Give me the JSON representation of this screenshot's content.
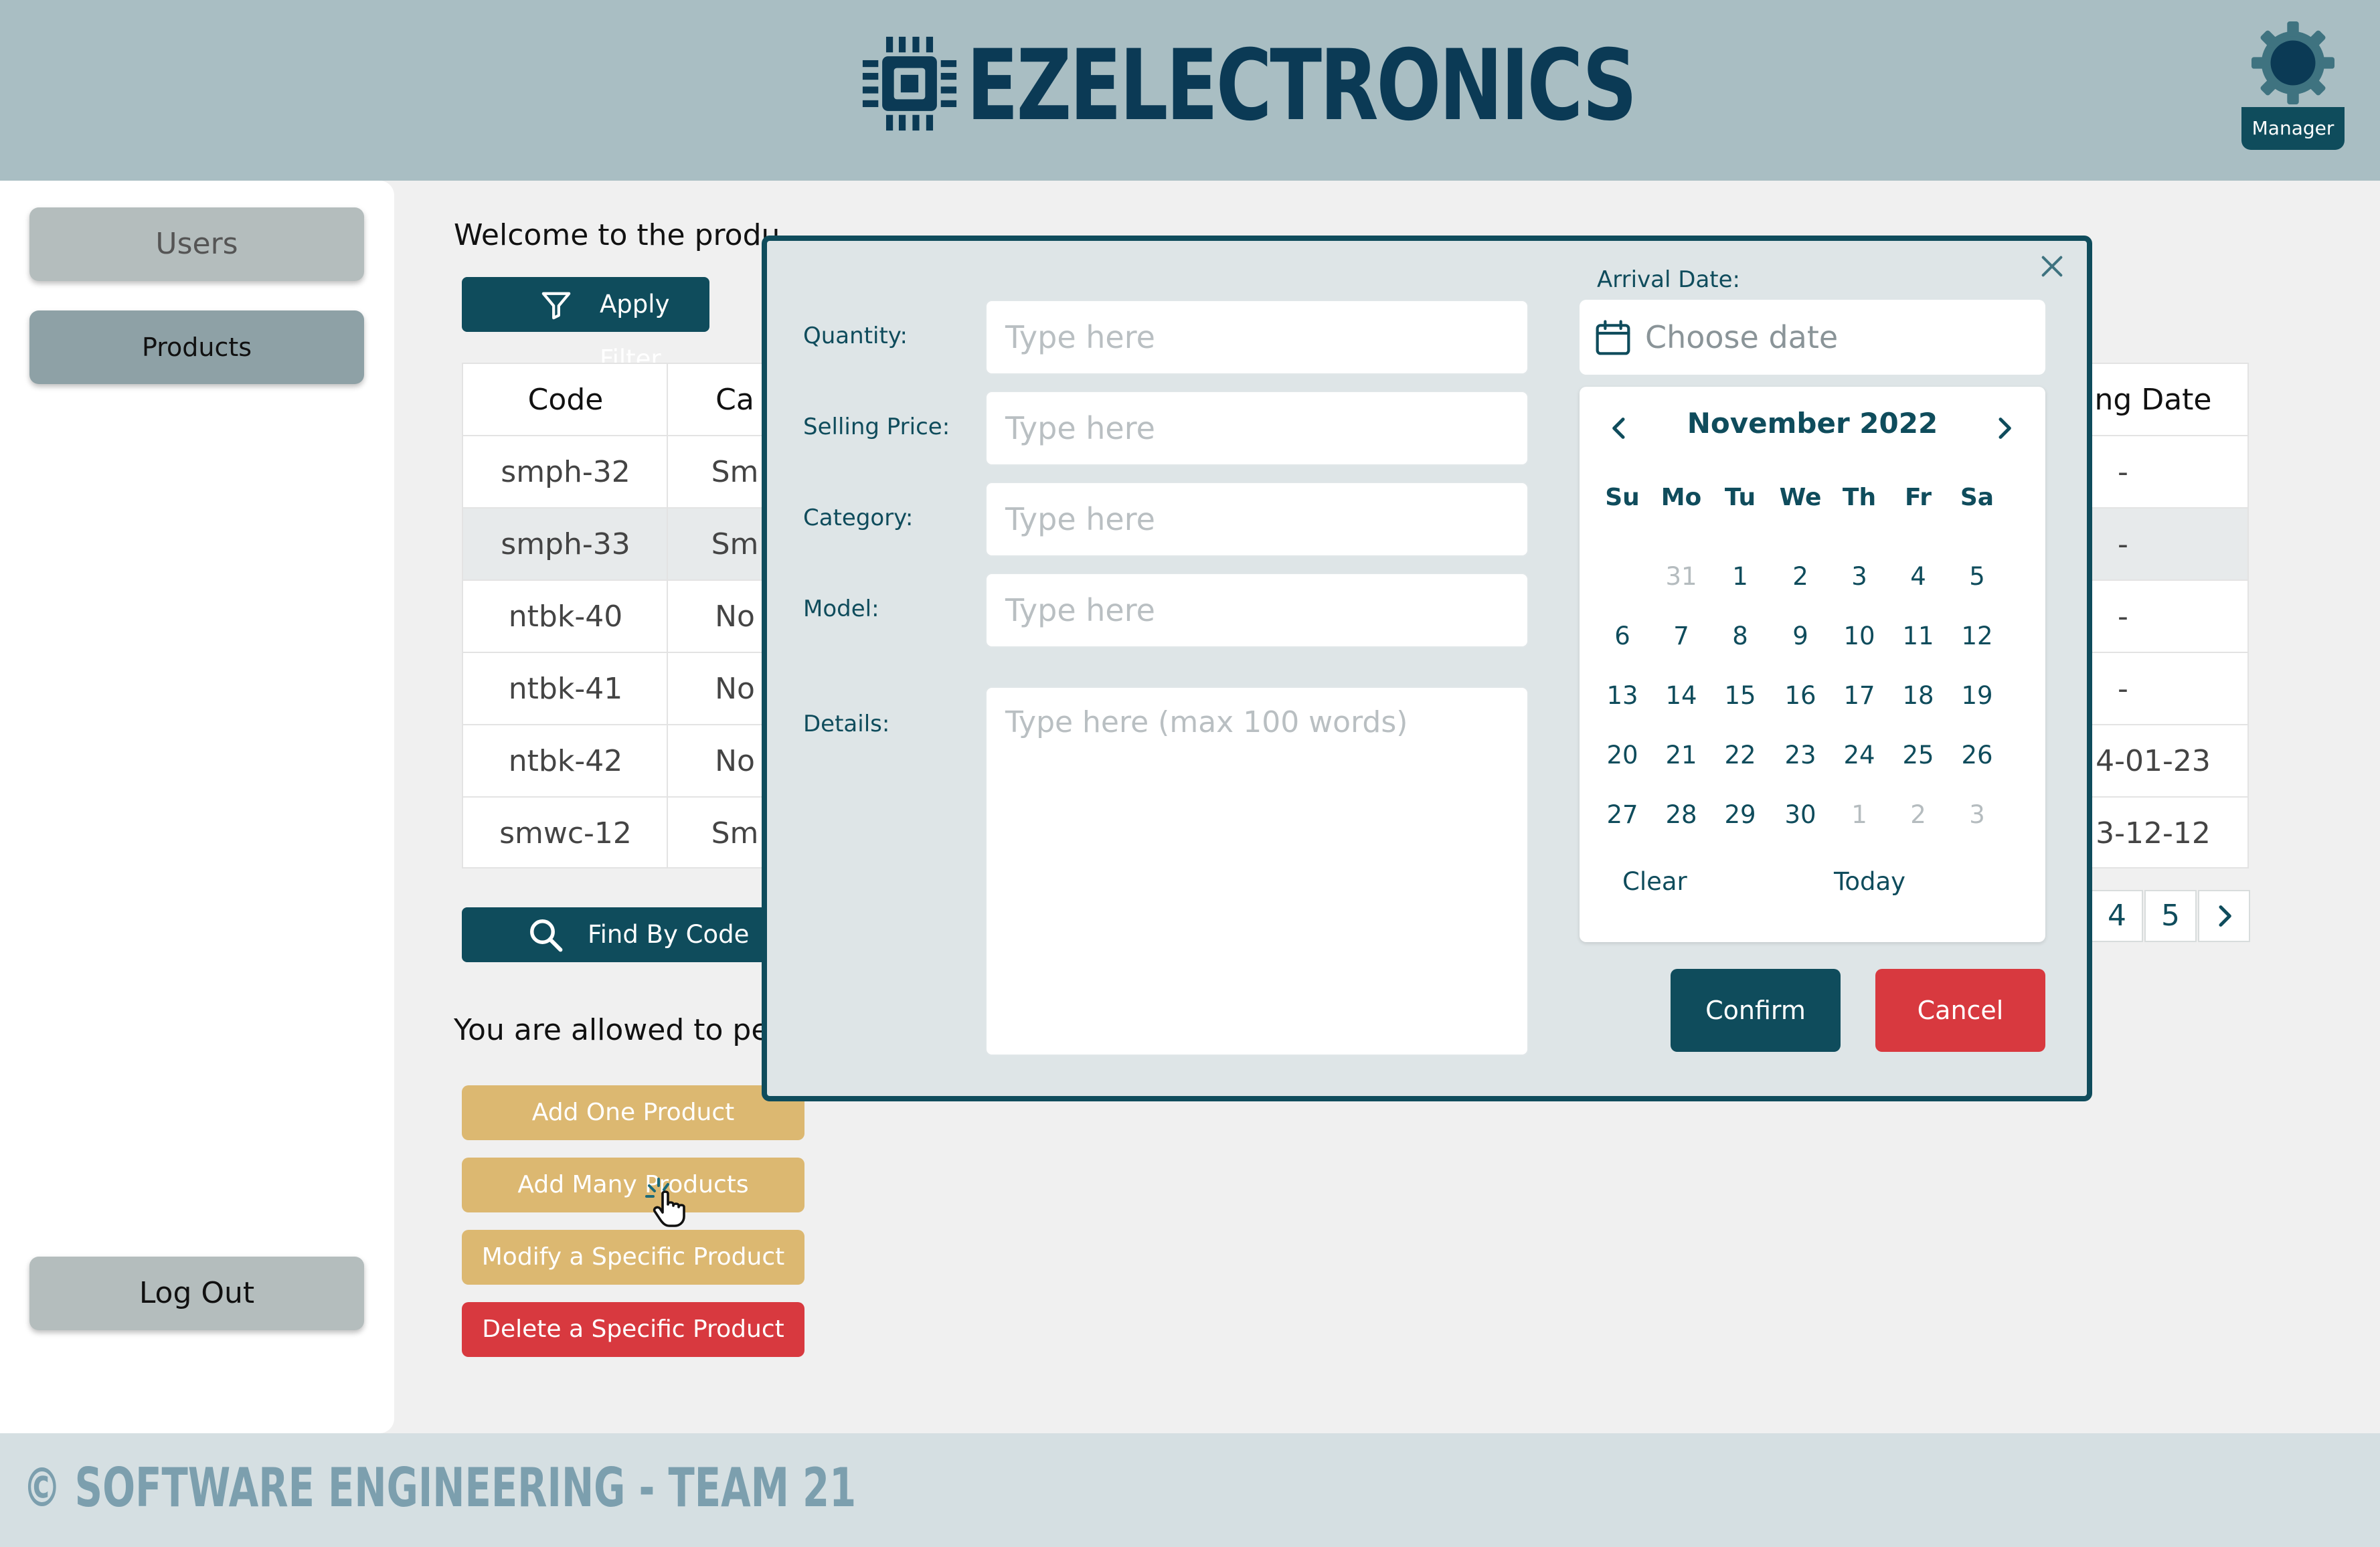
{
  "header": {
    "brand": "EZELECTRONICS",
    "role": "Manager"
  },
  "sidebar": {
    "items": [
      {
        "label": "Users"
      },
      {
        "label": "Products"
      }
    ],
    "logout": "Log Out"
  },
  "main": {
    "welcome": "Welcome to the produ",
    "apply_filter": "Apply Filter",
    "find_by_code": "Find By Code",
    "allowed": "You are allowed to per",
    "actions": [
      "Add One Product",
      "Add Many Products",
      "Modify a Specific Product",
      "Delete a Specific Product"
    ]
  },
  "table": {
    "headers": [
      "Code",
      "Ca",
      "ng Date"
    ],
    "rows": [
      [
        "smph-32",
        "Sm",
        "-"
      ],
      [
        "smph-33",
        "Sm",
        "-"
      ],
      [
        "ntbk-40",
        "No",
        "-"
      ],
      [
        "ntbk-41",
        "No",
        "-"
      ],
      [
        "ntbk-42",
        "No",
        "4-01-23"
      ],
      [
        "smwc-12",
        "Sm",
        "3-12-12"
      ]
    ]
  },
  "pagination": {
    "pages": [
      "4",
      "5"
    ],
    "next": "›"
  },
  "modal": {
    "fields": [
      {
        "label": "Quantity:",
        "placeholder": "Type here"
      },
      {
        "label": "Selling Price:",
        "placeholder": "Type here"
      },
      {
        "label": "Category:",
        "placeholder": "Type here"
      },
      {
        "label": "Model:",
        "placeholder": "Type here"
      }
    ],
    "details": {
      "label": "Details:",
      "placeholder": "Type here (max 100 words)"
    },
    "arrival": {
      "label": "Arrival Date:",
      "placeholder": "Choose date"
    },
    "calendar": {
      "title": "November 2022",
      "weekdays": [
        "Su",
        "Mo",
        "Tu",
        "We",
        "Th",
        "Fr",
        "Sa"
      ],
      "weeks": [
        [
          "",
          "31",
          "1",
          "2",
          "3",
          "4",
          "5"
        ],
        [
          "6",
          "7",
          "8",
          "9",
          "10",
          "11",
          "12"
        ],
        [
          "13",
          "14",
          "15",
          "16",
          "17",
          "18",
          "19"
        ],
        [
          "20",
          "21",
          "22",
          "23",
          "24",
          "25",
          "26"
        ],
        [
          "27",
          "28",
          "29",
          "30",
          "1",
          "2",
          "3"
        ]
      ],
      "clear": "Clear",
      "today": "Today"
    },
    "confirm": "Confirm",
    "cancel": "Cancel"
  },
  "footer": {
    "text": "© SOFTWARE ENGINEERING - TEAM 21"
  },
  "colors": {
    "primary": "#0f4c5c",
    "header_bg": "#a9bec3",
    "accent_gold": "#dcb871",
    "danger": "#d8393f"
  }
}
